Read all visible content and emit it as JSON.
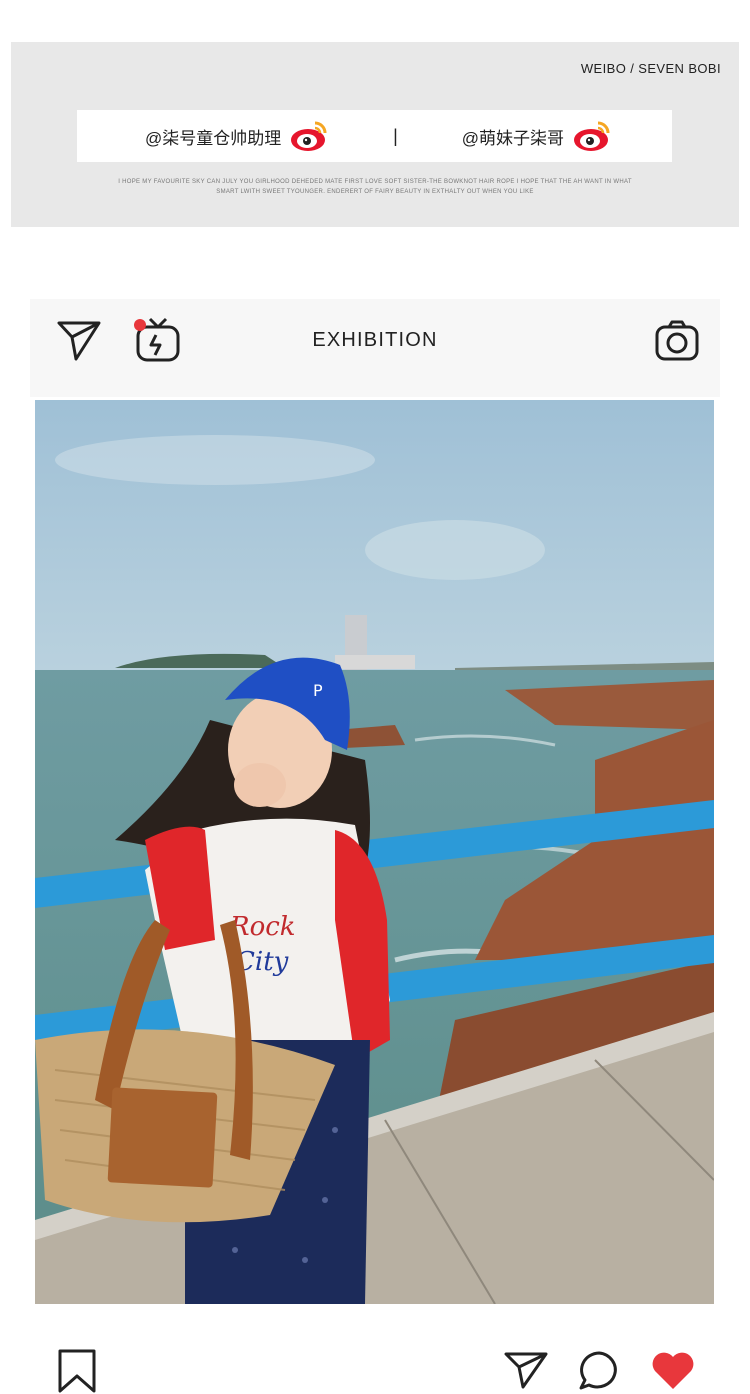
{
  "banner": {
    "brand": "WEIBO / SEVEN BOBI",
    "handle_right": "@萌妹子柒哥",
    "separator": "|",
    "handle_left": "@柒号童仓帅助理",
    "fine_print": "I HOPE MY FAVOURITE SKY CAN JULY YOU GIRLHOOD DEHEDED MATE FIRST LOVE SOFT SISTER-THE BOWKNOT HAIR ROPE I HOPE THAT THE AH WANT IN WHAT SMART LWITH SWEET TYOUNGER. ENDERERT OF FAIRY BEAUTY IN EXTHALTY OUT WHEN YOU LIKE"
  },
  "post": {
    "title": "EXHIBITION",
    "icons": {
      "send_top": "send-icon",
      "igtv": "igtv-icon",
      "camera": "camera-icon"
    },
    "photo_description": "photo-subject",
    "actions": {
      "bookmark": "bookmark-icon",
      "send": "send-icon",
      "comment": "comment-icon",
      "like": "heart-icon"
    }
  },
  "colors": {
    "banner_bg": "#e8e8e8",
    "header_bg": "#f7f7f7",
    "heart": "#e8373c",
    "weibo_red": "#e6162d",
    "weibo_orange": "#f5a623"
  }
}
